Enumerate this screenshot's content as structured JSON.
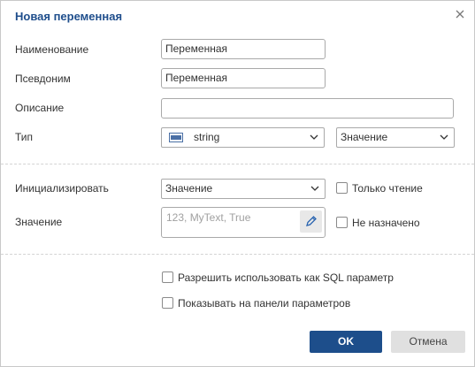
{
  "dialog": {
    "title": "Новая переменная",
    "close_icon": "close-icon"
  },
  "fields": {
    "name_label": "Наименование",
    "name_value": "Переменная",
    "alias_label": "Псевдоним",
    "alias_value": "Переменная",
    "description_label": "Описание",
    "description_value": "",
    "type_label": "Тип",
    "type_value": "string",
    "type_icon": "abc-type-icon",
    "type_mode_value": "Значение"
  },
  "init": {
    "label": "Инициализировать",
    "value": "Значение",
    "readonly_label": "Только чтение",
    "readonly_checked": false,
    "value_label": "Значение",
    "value_placeholder": "123, MyText, True",
    "not_assigned_label": "Не назначено",
    "not_assigned_checked": false
  },
  "options": {
    "sql_param_label": "Разрешить использовать как SQL параметр",
    "sql_param_checked": false,
    "show_panel_label": "Показывать на панели параметров",
    "show_panel_checked": false
  },
  "buttons": {
    "ok": "OK",
    "cancel": "Отмена"
  },
  "colors": {
    "title": "#1f4e8c",
    "ok_bg": "#1d4e8b",
    "cancel_bg": "#e0e0e0"
  }
}
